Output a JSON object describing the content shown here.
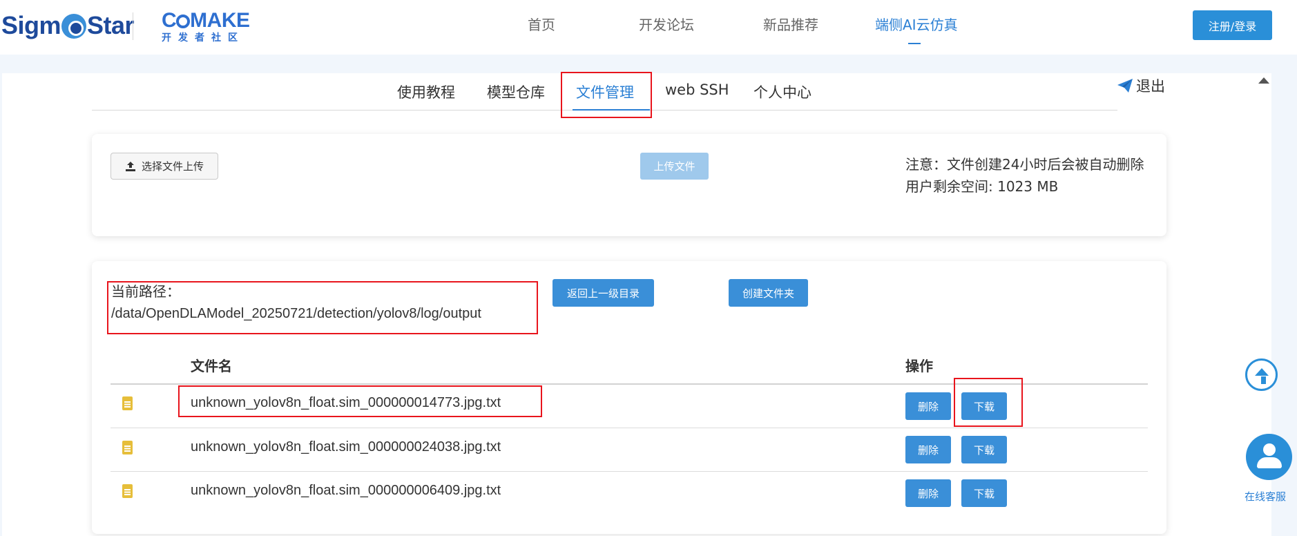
{
  "header": {
    "logo_text": "SigmStar",
    "brand_text": "CMAKE",
    "brand_sub": "开发者社区",
    "nav": [
      "首页",
      "开发论坛",
      "新品推荐",
      "端侧AI云仿真"
    ],
    "login_label": "注册/登录"
  },
  "subnav": {
    "tabs": [
      "使用教程",
      "模型仓库",
      "文件管理",
      "web SSH",
      "个人中心"
    ],
    "active_tab": "文件管理",
    "logout_label": "退出"
  },
  "upload": {
    "choose_label": "选择文件上传",
    "upload_label": "上传文件",
    "notice_line": "注意：文件创建24小时后会被自动删除",
    "space_line": "用户剩余空间: 1023 MB"
  },
  "files": {
    "path_label": "当前路径：",
    "path_value": "/data/OpenDLAModel_20250721/detection/yolov8/log/output",
    "back_label": "返回上一级目录",
    "mkdir_label": "创建文件夹",
    "col_name": "文件名",
    "col_ops": "操作",
    "rows": [
      {
        "name": "unknown_yolov8n_float.sim_000000014773.jpg.txt",
        "delete": "删除",
        "download": "下载"
      },
      {
        "name": "unknown_yolov8n_float.sim_000000024038.jpg.txt",
        "delete": "删除",
        "download": "下载"
      },
      {
        "name": "unknown_yolov8n_float.sim_000000006409.jpg.txt",
        "delete": "删除",
        "download": "下载"
      }
    ]
  },
  "widgets": {
    "back_to_top_icon": "arrow-up-circle-icon",
    "customer_service_label": "在线客服"
  },
  "colors": {
    "accent": "#2a7fd4",
    "button": "#3a8fd8",
    "highlight_box": "#e8141c"
  }
}
